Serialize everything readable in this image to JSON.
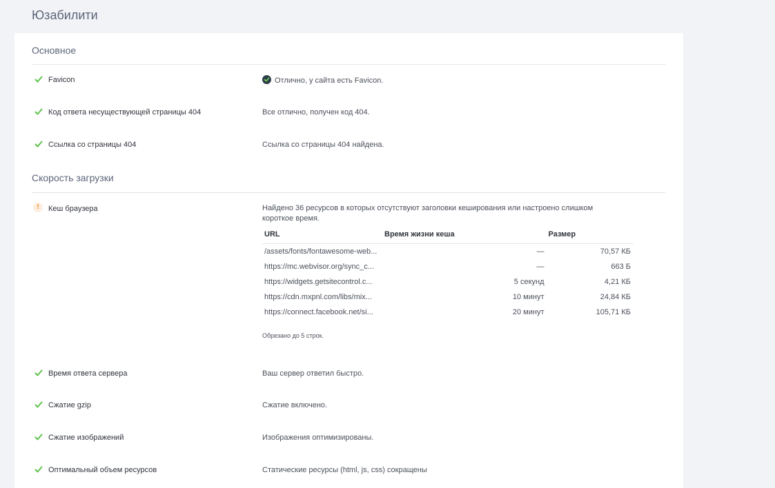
{
  "page": {
    "title": "Юзабилити"
  },
  "sections": {
    "basic": {
      "title": "Основное",
      "rows": [
        {
          "label": "Favicon",
          "desc": "Отлично, у сайта есть Favicon."
        },
        {
          "label": "Код ответа несуществующей страницы 404",
          "desc": "Все отлично, получен код 404."
        },
        {
          "label": "Ссылка со страницы 404",
          "desc": "Ссылка со страницы 404 найдена."
        }
      ]
    },
    "speed": {
      "title": "Скорость загрузки",
      "cache": {
        "label": "Кеш браузера",
        "desc": "Найдено 36 ресурсов в которых отсутствуют заголовки кеширования или настроено слишком короткое время.",
        "table": {
          "headers": {
            "url": "URL",
            "ttl": "Время жизни кеша",
            "size": "Размер"
          },
          "rows": [
            {
              "url": "/assets/fonts/fontawesome-web...",
              "ttl": "—",
              "size": "70,57 КБ"
            },
            {
              "url": "https://mc.webvisor.org/sync_c...",
              "ttl": "—",
              "size": "663 Б"
            },
            {
              "url": "https://widgets.getsitecontrol.c...",
              "ttl": "5 секунд",
              "size": "4,21 КБ"
            },
            {
              "url": "https://cdn.mxpnl.com/libs/mix...",
              "ttl": "10 минут",
              "size": "24,84 КБ"
            },
            {
              "url": "https://connect.facebook.net/si...",
              "ttl": "20 минут",
              "size": "105,71 КБ"
            }
          ]
        },
        "note": "Обрезано до 5 строк."
      },
      "rows": [
        {
          "label": "Время ответа сервера",
          "desc": "Ваш сервер ответил быстро."
        },
        {
          "label": "Сжатие gzip",
          "desc": "Сжатие включено."
        },
        {
          "label": "Сжатие изображений",
          "desc": "Изображения оптимизированы."
        },
        {
          "label": "Оптимальный объем ресурсов",
          "desc": "Статические ресурсы (html, js, css) сокращены"
        }
      ]
    }
  },
  "icons": {
    "ok": "check-icon",
    "warning": "exclamation-icon",
    "badge": "check-circle-icon"
  },
  "colors": {
    "ok": "#5cc24a",
    "warning": "#f08a2a",
    "badge": "#2f3e48"
  }
}
